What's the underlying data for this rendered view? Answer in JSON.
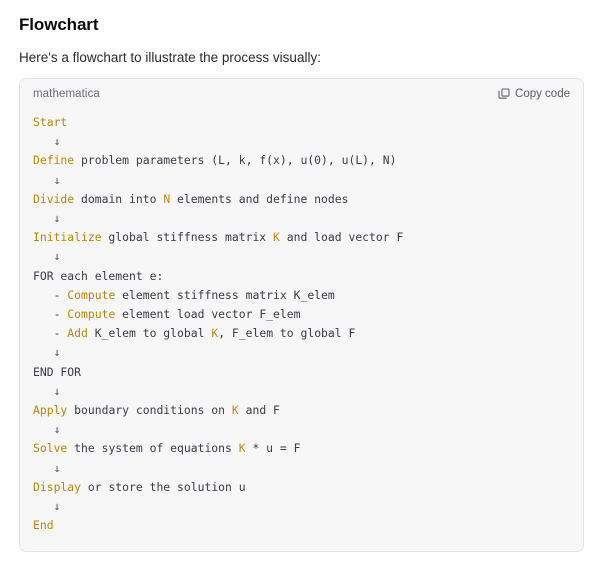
{
  "page": {
    "title": "Flowchart",
    "intro": "Here's a flowchart to illustrate the process visually:"
  },
  "code_block": {
    "language": "mathematica",
    "copy_label": "Copy code",
    "copy_icon": "copy-code-icon",
    "arrow_glyph": "↓",
    "colors": {
      "keyword": "#b8860b",
      "plain_text": "#3b3b42",
      "arrow": "#4a5568",
      "panel_background": "#f7f7f8",
      "panel_border": "#e2e2e4",
      "language_label": "#6b6b72"
    },
    "lines": [
      {
        "indent": 0,
        "segments": [
          {
            "t": "Start",
            "c": "kw"
          }
        ]
      },
      {
        "indent": 1,
        "segments": [
          {
            "t": "↓",
            "c": "arrow"
          }
        ]
      },
      {
        "indent": 0,
        "segments": [
          {
            "t": "Define",
            "c": "kw"
          },
          {
            "t": " problem parameters (L, k, f(x), u(0), u(L), N)",
            "c": "plain"
          }
        ]
      },
      {
        "indent": 1,
        "segments": [
          {
            "t": "↓",
            "c": "arrow"
          }
        ]
      },
      {
        "indent": 0,
        "segments": [
          {
            "t": "Divide",
            "c": "kw"
          },
          {
            "t": " domain into ",
            "c": "plain"
          },
          {
            "t": "N",
            "c": "kw2"
          },
          {
            "t": " elements and define nodes",
            "c": "plain"
          }
        ]
      },
      {
        "indent": 1,
        "segments": [
          {
            "t": "↓",
            "c": "arrow"
          }
        ]
      },
      {
        "indent": 0,
        "segments": [
          {
            "t": "Initialize",
            "c": "kw"
          },
          {
            "t": " global stiffness matrix ",
            "c": "plain"
          },
          {
            "t": "K",
            "c": "kw2"
          },
          {
            "t": " and load vector F",
            "c": "plain"
          }
        ]
      },
      {
        "indent": 1,
        "segments": [
          {
            "t": "↓",
            "c": "arrow"
          }
        ]
      },
      {
        "indent": 0,
        "segments": [
          {
            "t": "FOR each element e:",
            "c": "plain"
          }
        ]
      },
      {
        "indent": 1,
        "segments": [
          {
            "t": "- ",
            "c": "plain"
          },
          {
            "t": "Compute",
            "c": "kw"
          },
          {
            "t": " element stiffness matrix K_elem",
            "c": "plain"
          }
        ]
      },
      {
        "indent": 1,
        "segments": [
          {
            "t": "- ",
            "c": "plain"
          },
          {
            "t": "Compute",
            "c": "kw"
          },
          {
            "t": " element load vector F_elem",
            "c": "plain"
          }
        ]
      },
      {
        "indent": 1,
        "segments": [
          {
            "t": "- ",
            "c": "plain"
          },
          {
            "t": "Add",
            "c": "kw"
          },
          {
            "t": " K_elem to global ",
            "c": "plain"
          },
          {
            "t": "K",
            "c": "kw2"
          },
          {
            "t": ", F_elem to global F",
            "c": "plain"
          }
        ]
      },
      {
        "indent": 1,
        "segments": [
          {
            "t": "↓",
            "c": "arrow"
          }
        ]
      },
      {
        "indent": 0,
        "segments": [
          {
            "t": "END FOR",
            "c": "plain"
          }
        ]
      },
      {
        "indent": 1,
        "segments": [
          {
            "t": "↓",
            "c": "arrow"
          }
        ]
      },
      {
        "indent": 0,
        "segments": [
          {
            "t": "Apply",
            "c": "kw"
          },
          {
            "t": " boundary conditions on ",
            "c": "plain"
          },
          {
            "t": "K",
            "c": "kw2"
          },
          {
            "t": " and F",
            "c": "plain"
          }
        ]
      },
      {
        "indent": 1,
        "segments": [
          {
            "t": "↓",
            "c": "arrow"
          }
        ]
      },
      {
        "indent": 0,
        "segments": [
          {
            "t": "Solve",
            "c": "kw"
          },
          {
            "t": " the system of equations ",
            "c": "plain"
          },
          {
            "t": "K",
            "c": "kw2"
          },
          {
            "t": " * u = F",
            "c": "plain"
          }
        ]
      },
      {
        "indent": 1,
        "segments": [
          {
            "t": "↓",
            "c": "arrow"
          }
        ]
      },
      {
        "indent": 0,
        "segments": [
          {
            "t": "Display",
            "c": "kw"
          },
          {
            "t": " or store the solution u",
            "c": "plain"
          }
        ]
      },
      {
        "indent": 1,
        "segments": [
          {
            "t": "↓",
            "c": "arrow"
          }
        ]
      },
      {
        "indent": 0,
        "segments": [
          {
            "t": "End",
            "c": "kw"
          }
        ]
      }
    ]
  }
}
